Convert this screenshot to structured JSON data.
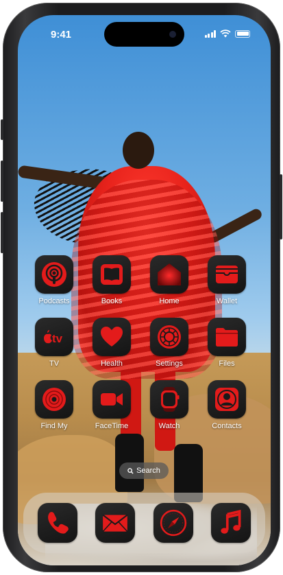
{
  "status_bar": {
    "time": "9:41"
  },
  "home_apps": [
    {
      "label": "Podcasts",
      "icon": "podcasts-icon"
    },
    {
      "label": "Books",
      "icon": "books-icon"
    },
    {
      "label": "Home",
      "icon": "home-icon"
    },
    {
      "label": "Wallet",
      "icon": "wallet-icon"
    },
    {
      "label": "TV",
      "icon": "tv-icon"
    },
    {
      "label": "Health",
      "icon": "heart-icon"
    },
    {
      "label": "Settings",
      "icon": "gear-icon"
    },
    {
      "label": "Files",
      "icon": "folder-icon"
    },
    {
      "label": "Find My",
      "icon": "find-my-icon"
    },
    {
      "label": "FaceTime",
      "icon": "video-camera-icon"
    },
    {
      "label": "Watch",
      "icon": "watch-icon"
    },
    {
      "label": "Contacts",
      "icon": "contacts-icon"
    }
  ],
  "search": {
    "label": "Search",
    "icon": "search-icon"
  },
  "dock": [
    {
      "icon": "phone-icon"
    },
    {
      "icon": "mail-icon"
    },
    {
      "icon": "compass-icon"
    },
    {
      "icon": "music-note-icon"
    }
  ],
  "tv_icon_text": "tv",
  "colors": {
    "icon_tint": "#e31b1b",
    "tile_bg": "#1a1a1a",
    "sky": "#4a95d8"
  }
}
